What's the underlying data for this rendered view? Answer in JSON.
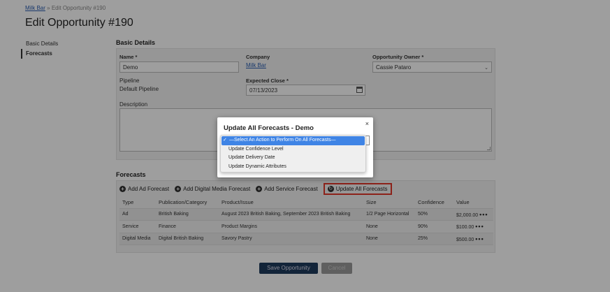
{
  "breadcrumb": {
    "root": "Milk Bar",
    "separator": "»",
    "current": "Edit Opportunity #190"
  },
  "page_title": "Edit Opportunity #190",
  "sidenav": {
    "items": [
      {
        "label": "Basic Details"
      },
      {
        "label": "Forecasts"
      }
    ]
  },
  "basic_details": {
    "section_title": "Basic Details",
    "name_label": "Name *",
    "name_value": "Demo",
    "company_label": "Company",
    "company_value": "Milk Bar",
    "owner_label": "Opportunity Owner *",
    "owner_value": "Cassie Pataro",
    "pipeline_label": "Pipeline",
    "pipeline_value": "Default Pipeline",
    "close_label": "Expected Close *",
    "close_value": "07/13/2023",
    "description_label": "Description"
  },
  "forecasts": {
    "section_title": "Forecasts",
    "toolbar": {
      "add_ad": "Add Ad Forecast",
      "add_digital": "Add Digital Media Forecast",
      "add_service": "Add Service Forecast",
      "update_all": "Update All Forecasts"
    },
    "columns": [
      "Type",
      "Publication/Category",
      "Product/Issue",
      "Size",
      "Confidence",
      "Value"
    ],
    "rows": [
      [
        "Ad",
        "British Baking",
        "August 2023 British Baking, September 2023 British Baking",
        "1/2 Page Horizontal",
        "50%",
        "$2,000.00"
      ],
      [
        "Service",
        "Finance",
        "Product Margins",
        "None",
        "90%",
        "$100.00"
      ],
      [
        "Digital Media",
        "Digital British Baking",
        "Savory Pastry",
        "None",
        "25%",
        "$500.00"
      ]
    ],
    "row_menu": "•••"
  },
  "actions": {
    "save": "Save Opportunity",
    "cancel": "Cancel"
  },
  "modal": {
    "title": "Update All Forecasts - Demo",
    "close": "×",
    "options": [
      "—Select An Action to Perform On All Forecasts—",
      "Update Confidence Level",
      "Update Delivery Date",
      "Update Dynamic Attributes"
    ],
    "selected_check": "✓"
  },
  "colors": {
    "highlight": "#e2382b",
    "selection": "#3f84e5",
    "primary_button": "#1e3a5c"
  }
}
